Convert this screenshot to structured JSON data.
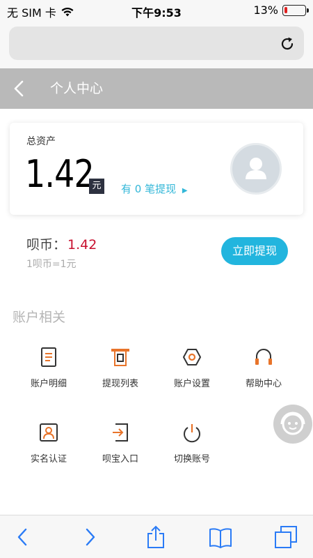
{
  "status_bar": {
    "carrier": "无 SIM 卡",
    "time": "下午9:53",
    "battery_percent": "13%",
    "battery_level": 0.13
  },
  "browser": {
    "url_text": ""
  },
  "header": {
    "title": "个人中心"
  },
  "asset": {
    "label": "总资产",
    "amount": "1.42",
    "unit": "元",
    "withdraw_prefix": "有",
    "withdraw_count": "0",
    "withdraw_suffix": "笔提现"
  },
  "coins": {
    "label": "呗币：",
    "value": "1.42",
    "rate": "1呗币=1元",
    "withdraw_button": "立即提现"
  },
  "account": {
    "section_title": "账户相关",
    "items": [
      {
        "label": "账户明细",
        "icon": "document-icon"
      },
      {
        "label": "提现列表",
        "icon": "withdraw-list-icon"
      },
      {
        "label": "账户设置",
        "icon": "settings-icon"
      },
      {
        "label": "帮助中心",
        "icon": "headset-icon"
      },
      {
        "label": "实名认证",
        "icon": "id-card-icon"
      },
      {
        "label": "呗宝入口",
        "icon": "login-icon"
      },
      {
        "label": "切换账号",
        "icon": "power-icon"
      }
    ]
  },
  "colors": {
    "accent": "#22b5de",
    "link": "#33b7d8",
    "coin_value": "#c8102e",
    "icon_orange": "#e8742a",
    "icon_dark": "#333333",
    "header_bg": "#b9b9b9"
  }
}
